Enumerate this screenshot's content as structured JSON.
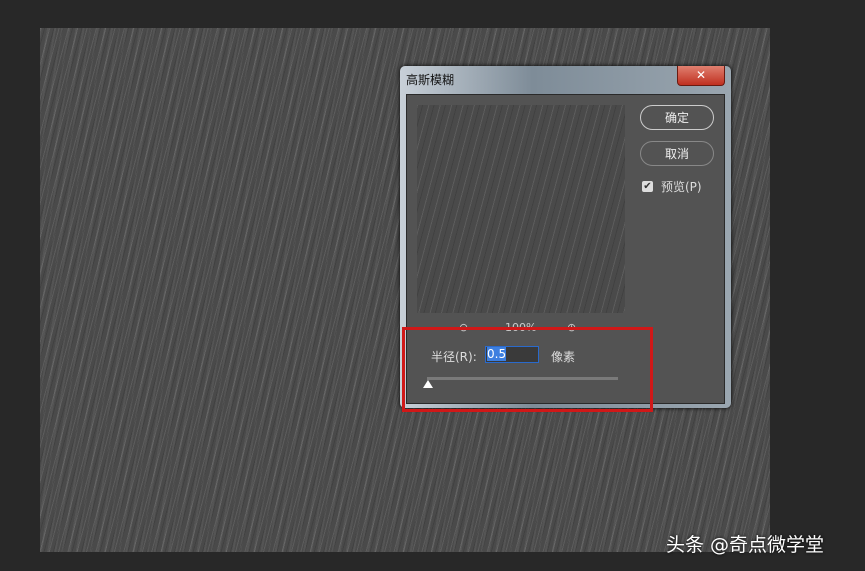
{
  "dialog": {
    "title": "高斯模糊",
    "close": "✕",
    "ok": "确定",
    "cancel": "取消",
    "preview_label": "预览(P)",
    "preview_checked": true,
    "zoom_level": "100%",
    "radius_label": "半径(R):",
    "radius_value": "0.5",
    "unit": "像素",
    "slider_fraction": 0.0
  },
  "watermark": "头条 @奇点微学堂",
  "colors": {
    "highlight": "#d01818"
  }
}
